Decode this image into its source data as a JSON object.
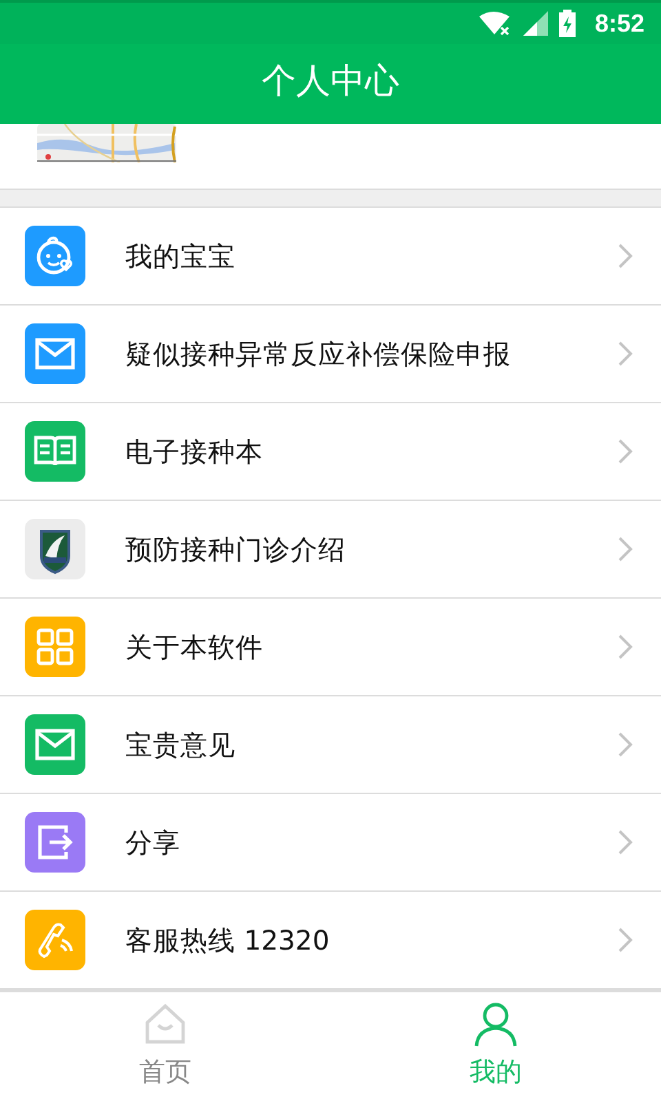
{
  "status_bar": {
    "time": "8:52"
  },
  "header": {
    "title": "个人中心"
  },
  "menu": [
    {
      "label": "我的宝宝",
      "kind": "baby",
      "color": "#1e9bff"
    },
    {
      "label": "疑似接种异常反应补偿保险申报",
      "kind": "mail",
      "color": "#1e9bff"
    },
    {
      "label": "电子接种本",
      "kind": "book",
      "color": "#14bb64"
    },
    {
      "label": "预防接种门诊介绍",
      "kind": "shield",
      "color": "#ececec"
    },
    {
      "label": "关于本软件",
      "kind": "grid",
      "color": "#ffb400"
    },
    {
      "label": "宝贵意见",
      "kind": "mail",
      "color": "#14bb64"
    },
    {
      "label": "分享",
      "kind": "share",
      "color": "#9a7af5"
    },
    {
      "label": "客服热线 12320",
      "kind": "phone",
      "color": "#ffb400"
    }
  ],
  "bottom_nav": [
    {
      "label": "首页",
      "kind": "home",
      "selected": false
    },
    {
      "label": "我的",
      "kind": "person",
      "selected": true
    }
  ]
}
